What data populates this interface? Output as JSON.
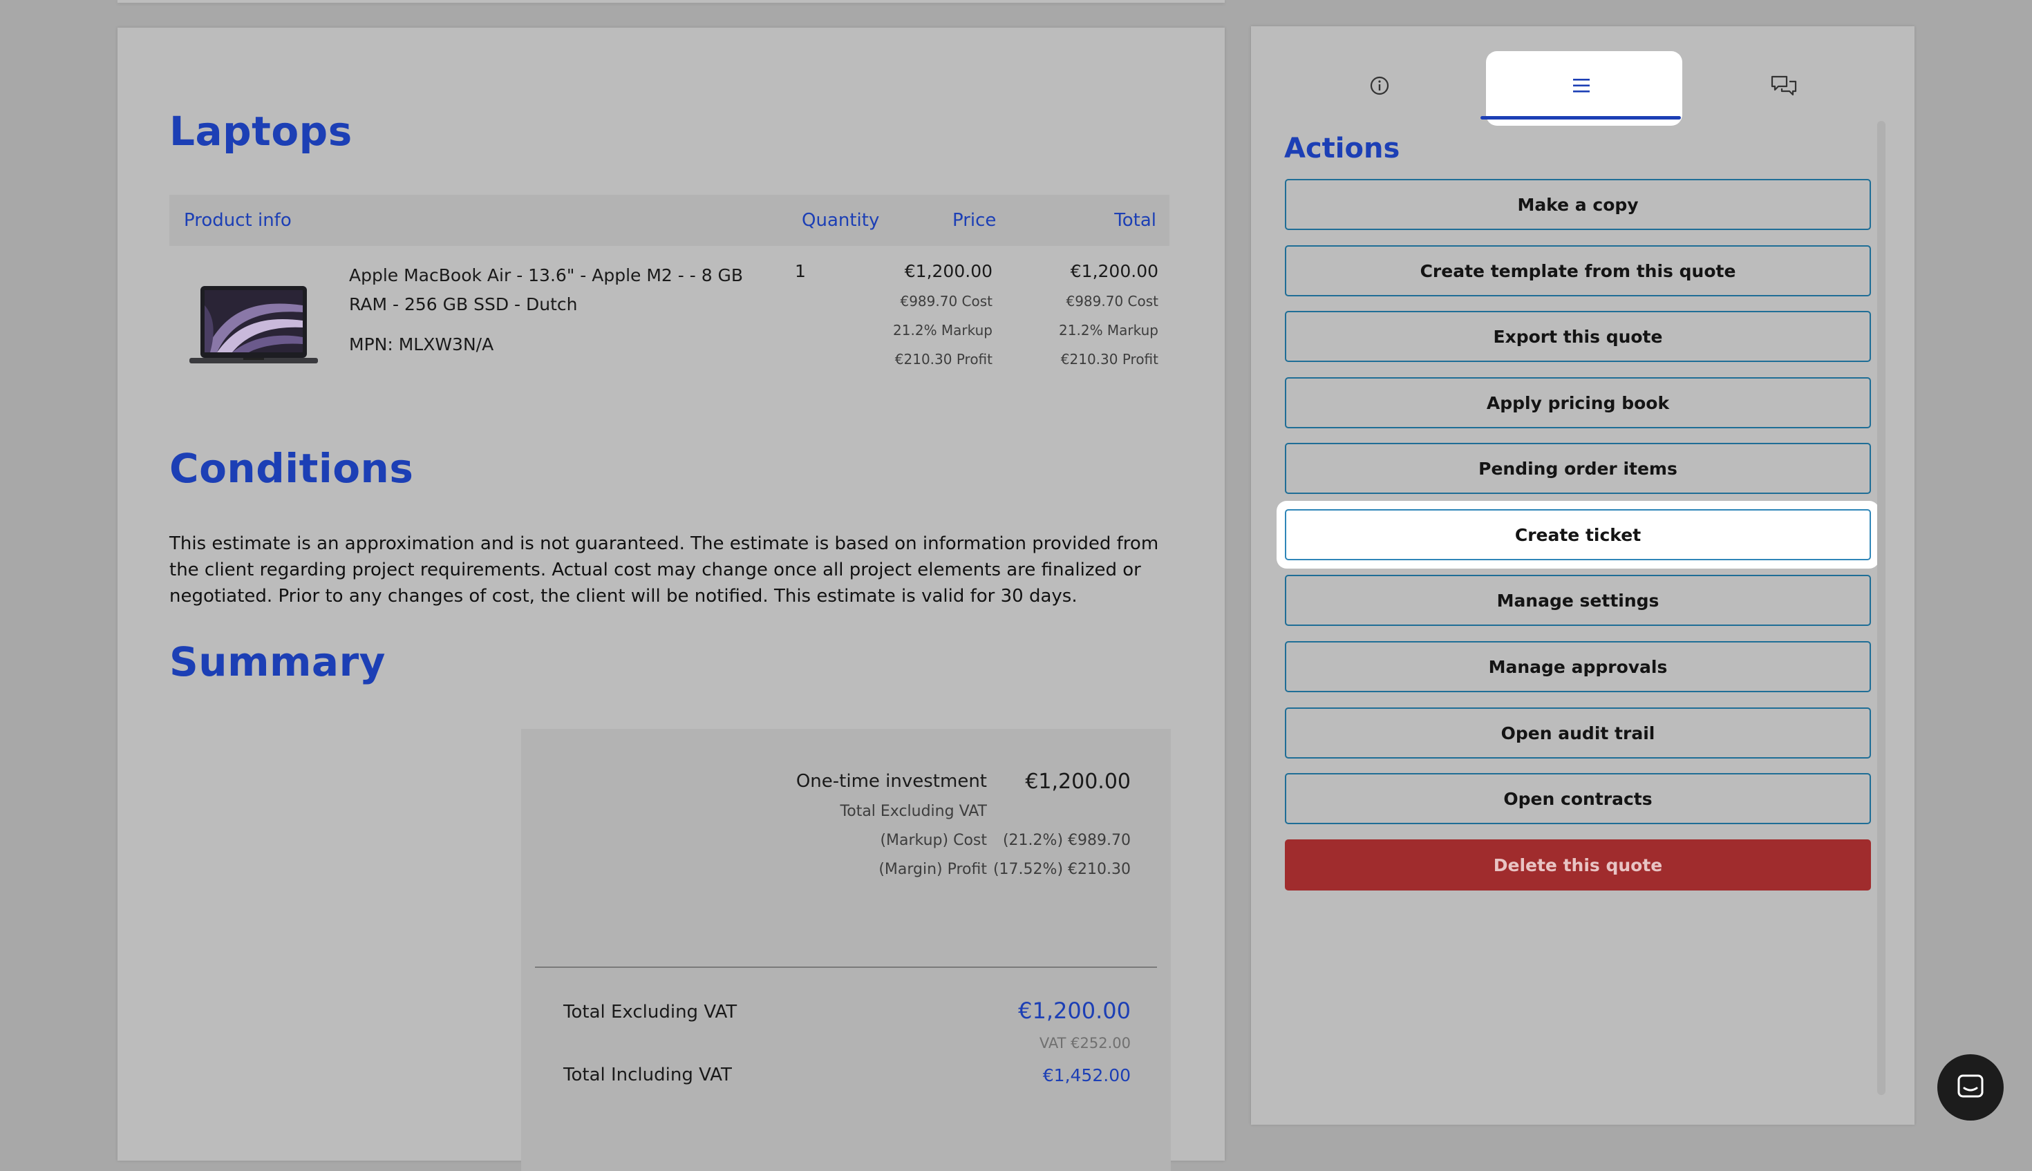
{
  "document": {
    "section_laptops": "Laptops",
    "table_headers": {
      "product_info": "Product info",
      "quantity": "Quantity",
      "price": "Price",
      "total": "Total"
    },
    "line_item": {
      "title_line1": "Apple MacBook Air - 13.6\" - Apple M2 - - 8 GB",
      "title_line2": "RAM - 256 GB SSD - Dutch",
      "mpn": "MPN: MLXW3N/A",
      "quantity": "1",
      "price": "€1,200.00",
      "price_cost": "€989.70 Cost",
      "price_markup": "21.2% Markup",
      "price_profit": "€210.30 Profit",
      "total": "€1,200.00",
      "total_cost": "€989.70 Cost",
      "total_markup": "21.2% Markup",
      "total_profit": "€210.30 Profit"
    },
    "section_conditions": "Conditions",
    "conditions_text": "This estimate is an approximation and is not guaranteed. The estimate is based on information provided from the client regarding project requirements. Actual cost may change once all project elements are finalized or negotiated. Prior to any changes of cost, the client will be notified. This estimate is valid for 30 days.",
    "section_summary": "Summary",
    "summary": {
      "one_time_label": "One-time investment",
      "one_time_value": "€1,200.00",
      "total_excl_vat_small": "Total Excluding VAT",
      "markup_cost_label": "(Markup) Cost",
      "markup_cost_value": "(21.2%) €989.70",
      "margin_profit_label": "(Margin) Profit",
      "margin_profit_value": "(17.52%) €210.30",
      "total_excl_label": "Total Excluding VAT",
      "total_excl_value": "€1,200.00",
      "vat_value": "VAT €252.00",
      "total_incl_label": "Total Including VAT",
      "total_incl_value": "€1,452.00"
    }
  },
  "sidebar": {
    "tabs": [
      {
        "icon": "info-icon"
      },
      {
        "icon": "menu-icon",
        "active": true
      },
      {
        "icon": "chat-bubbles-icon"
      }
    ],
    "actions_title": "Actions",
    "actions": [
      "Make a copy",
      "Create template from this quote",
      "Export this quote",
      "Apply pricing book",
      "Pending order items",
      "Create ticket",
      "Manage settings",
      "Manage approvals",
      "Open audit trail",
      "Open contracts",
      "Delete this quote"
    ]
  },
  "colors": {
    "accent": "#1c3fb5",
    "danger": "#a02c2d",
    "button_border": "#1f6e96"
  }
}
